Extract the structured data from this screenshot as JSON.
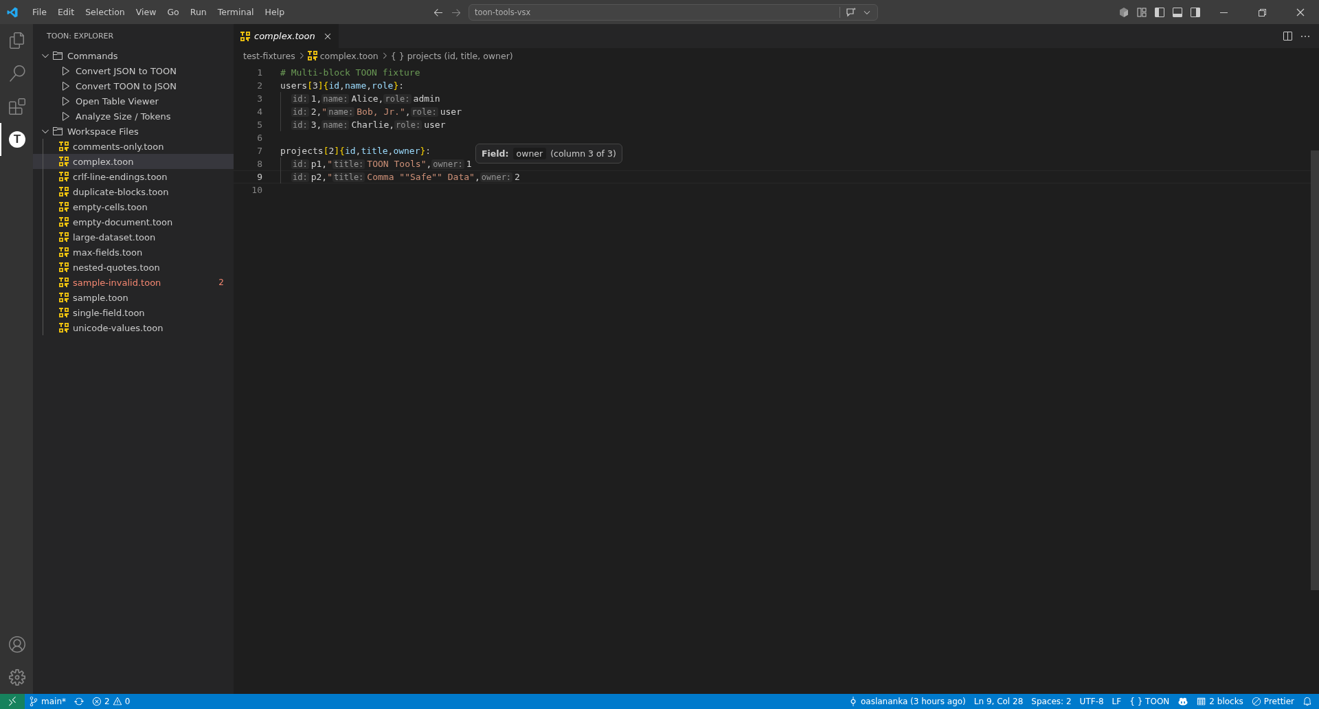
{
  "menu": [
    "File",
    "Edit",
    "Selection",
    "View",
    "Go",
    "Run",
    "Terminal",
    "Help"
  ],
  "command_center": {
    "value": "toon-tools-vsx"
  },
  "activity_bar": [
    {
      "kind": "explorer",
      "selected": false
    },
    {
      "kind": "search",
      "selected": false
    },
    {
      "kind": "extensions",
      "selected": false
    },
    {
      "kind": "toon",
      "glyph": "T",
      "selected": true
    }
  ],
  "activity_bottom": [
    {
      "kind": "accounts"
    },
    {
      "kind": "settings"
    }
  ],
  "sidebar": {
    "title": "TOON: EXPLORER",
    "sections": [
      {
        "label": "Commands",
        "expanded": true,
        "children": [
          {
            "kind": "command",
            "label": "Convert JSON to TOON"
          },
          {
            "kind": "command",
            "label": "Convert TOON to JSON"
          },
          {
            "kind": "command",
            "label": "Open Table Viewer"
          },
          {
            "kind": "command",
            "label": "Analyze Size / Tokens"
          }
        ]
      },
      {
        "label": "Workspace Files",
        "expanded": true,
        "children": [
          {
            "kind": "file",
            "label": "comments-only.toon",
            "selected": false,
            "error": false
          },
          {
            "kind": "file",
            "label": "complex.toon",
            "selected": true,
            "error": false
          },
          {
            "kind": "file",
            "label": "crlf-line-endings.toon",
            "selected": false,
            "error": false
          },
          {
            "kind": "file",
            "label": "duplicate-blocks.toon",
            "selected": false,
            "error": false
          },
          {
            "kind": "file",
            "label": "empty-cells.toon",
            "selected": false,
            "error": false
          },
          {
            "kind": "file",
            "label": "empty-document.toon",
            "selected": false,
            "error": false
          },
          {
            "kind": "file",
            "label": "large-dataset.toon",
            "selected": false,
            "error": false
          },
          {
            "kind": "file",
            "label": "max-fields.toon",
            "selected": false,
            "error": false
          },
          {
            "kind": "file",
            "label": "nested-quotes.toon",
            "selected": false,
            "error": false
          },
          {
            "kind": "file",
            "label": "sample-invalid.toon",
            "selected": false,
            "error": true,
            "problems": "2"
          },
          {
            "kind": "file",
            "label": "sample.toon",
            "selected": false,
            "error": false
          },
          {
            "kind": "file",
            "label": "single-field.toon",
            "selected": false,
            "error": false
          },
          {
            "kind": "file",
            "label": "unicode-values.toon",
            "selected": false,
            "error": false
          }
        ]
      }
    ]
  },
  "tabs": [
    {
      "label": "complex.toon",
      "selected": true,
      "preview": true
    }
  ],
  "breadcrumbs": [
    {
      "kind": "folder",
      "label": "test-fixtures"
    },
    {
      "kind": "file",
      "label": "complex.toon"
    },
    {
      "kind": "symbol",
      "icon": "{ }",
      "label": "projects (id, title, owner)"
    }
  ],
  "editor": {
    "lines": [
      {
        "number": "1",
        "current": false,
        "indent": false,
        "tokens": [
          {
            "kind": "comment",
            "text": "# Multi-block TOON fixture"
          }
        ]
      },
      {
        "number": "2",
        "current": false,
        "indent": false,
        "tokens": [
          {
            "kind": "plain",
            "text": "users"
          },
          {
            "kind": "bracket",
            "text": "["
          },
          {
            "kind": "plain",
            "text": "3"
          },
          {
            "kind": "bracket",
            "text": "]{"
          },
          {
            "kind": "field",
            "text": "id"
          },
          {
            "kind": "plain",
            "text": ","
          },
          {
            "kind": "field",
            "text": "name"
          },
          {
            "kind": "plain",
            "text": ","
          },
          {
            "kind": "field",
            "text": "role"
          },
          {
            "kind": "bracket",
            "text": "}"
          },
          {
            "kind": "plain",
            "text": ":"
          }
        ]
      },
      {
        "number": "3",
        "current": false,
        "indent": true,
        "tokens": [
          {
            "kind": "hint",
            "text": "id:"
          },
          {
            "kind": "plain",
            "text": "1,"
          },
          {
            "kind": "hint",
            "text": "name:"
          },
          {
            "kind": "plain",
            "text": "Alice,"
          },
          {
            "kind": "hint",
            "text": "role:"
          },
          {
            "kind": "plain",
            "text": "admin"
          }
        ]
      },
      {
        "number": "4",
        "current": false,
        "indent": true,
        "tokens": [
          {
            "kind": "hint",
            "text": "id:"
          },
          {
            "kind": "plain",
            "text": "2,"
          },
          {
            "kind": "string",
            "text": "\""
          },
          {
            "kind": "hint",
            "text": "name:"
          },
          {
            "kind": "string",
            "text": "Bob, Jr.\""
          },
          {
            "kind": "plain",
            "text": ","
          },
          {
            "kind": "hint",
            "text": "role:"
          },
          {
            "kind": "plain",
            "text": "user"
          }
        ]
      },
      {
        "number": "5",
        "current": false,
        "indent": true,
        "tokens": [
          {
            "kind": "hint",
            "text": "id:"
          },
          {
            "kind": "plain",
            "text": "3,"
          },
          {
            "kind": "hint",
            "text": "name:"
          },
          {
            "kind": "plain",
            "text": "Charlie,"
          },
          {
            "kind": "hint",
            "text": "role:"
          },
          {
            "kind": "plain",
            "text": "user"
          }
        ]
      },
      {
        "number": "6",
        "current": false,
        "indent": false
      },
      {
        "number": "7",
        "current": false,
        "indent": false,
        "tokens": [
          {
            "kind": "plain",
            "text": "projects"
          },
          {
            "kind": "bracket",
            "text": "["
          },
          {
            "kind": "plain",
            "text": "2"
          },
          {
            "kind": "bracket",
            "text": "]{"
          },
          {
            "kind": "field",
            "text": "id"
          },
          {
            "kind": "plain",
            "text": ","
          },
          {
            "kind": "field",
            "text": "title"
          },
          {
            "kind": "plain",
            "text": ","
          },
          {
            "kind": "field",
            "text": "owner"
          },
          {
            "kind": "bracket",
            "text": "}"
          },
          {
            "kind": "plain",
            "text": ":"
          }
        ]
      },
      {
        "number": "8",
        "current": false,
        "indent": true,
        "tokens": [
          {
            "kind": "hint",
            "text": "id:"
          },
          {
            "kind": "plain",
            "text": "p1,"
          },
          {
            "kind": "string",
            "text": "\""
          },
          {
            "kind": "hint",
            "text": "title:"
          },
          {
            "kind": "string",
            "text": "TOON Tools\""
          },
          {
            "kind": "plain",
            "text": ","
          },
          {
            "kind": "hint",
            "text": "owner:"
          },
          {
            "kind": "plain",
            "text": "1"
          }
        ]
      },
      {
        "number": "9",
        "current": true,
        "indent": true,
        "tokens": [
          {
            "kind": "hint",
            "text": "id:"
          },
          {
            "kind": "plain",
            "text": "p2,"
          },
          {
            "kind": "string",
            "text": "\""
          },
          {
            "kind": "hint",
            "text": "title:"
          },
          {
            "kind": "string",
            "text": "Comma \"\"Safe\"\" Data\""
          },
          {
            "kind": "plain",
            "text": ","
          },
          {
            "kind": "hint",
            "text": "owner:"
          },
          {
            "kind": "plain",
            "text": "2"
          }
        ]
      },
      {
        "number": "10",
        "current": false,
        "indent": false
      }
    ]
  },
  "hover": {
    "label": "Field:",
    "field": "owner",
    "detail": "(column 3 of 3)"
  },
  "status_bar": {
    "left": [
      {
        "kind": "remote"
      },
      {
        "kind": "branch",
        "label": "main*"
      },
      {
        "kind": "sync"
      },
      {
        "kind": "problems",
        "errors": "2",
        "warnings": "0"
      }
    ],
    "right": [
      {
        "kind": "blame",
        "label": "oaslananka (3 hours ago)"
      },
      {
        "kind": "text",
        "label": "Ln 9, Col 28"
      },
      {
        "kind": "text",
        "label": "Spaces: 2"
      },
      {
        "kind": "text",
        "label": "UTF-8"
      },
      {
        "kind": "text",
        "label": "LF"
      },
      {
        "kind": "language",
        "icon": "{ }",
        "label": "TOON"
      },
      {
        "kind": "copilot"
      },
      {
        "kind": "blocks",
        "label": "2 blocks"
      },
      {
        "kind": "prettier",
        "label": "Prettier"
      },
      {
        "kind": "bell"
      }
    ]
  }
}
